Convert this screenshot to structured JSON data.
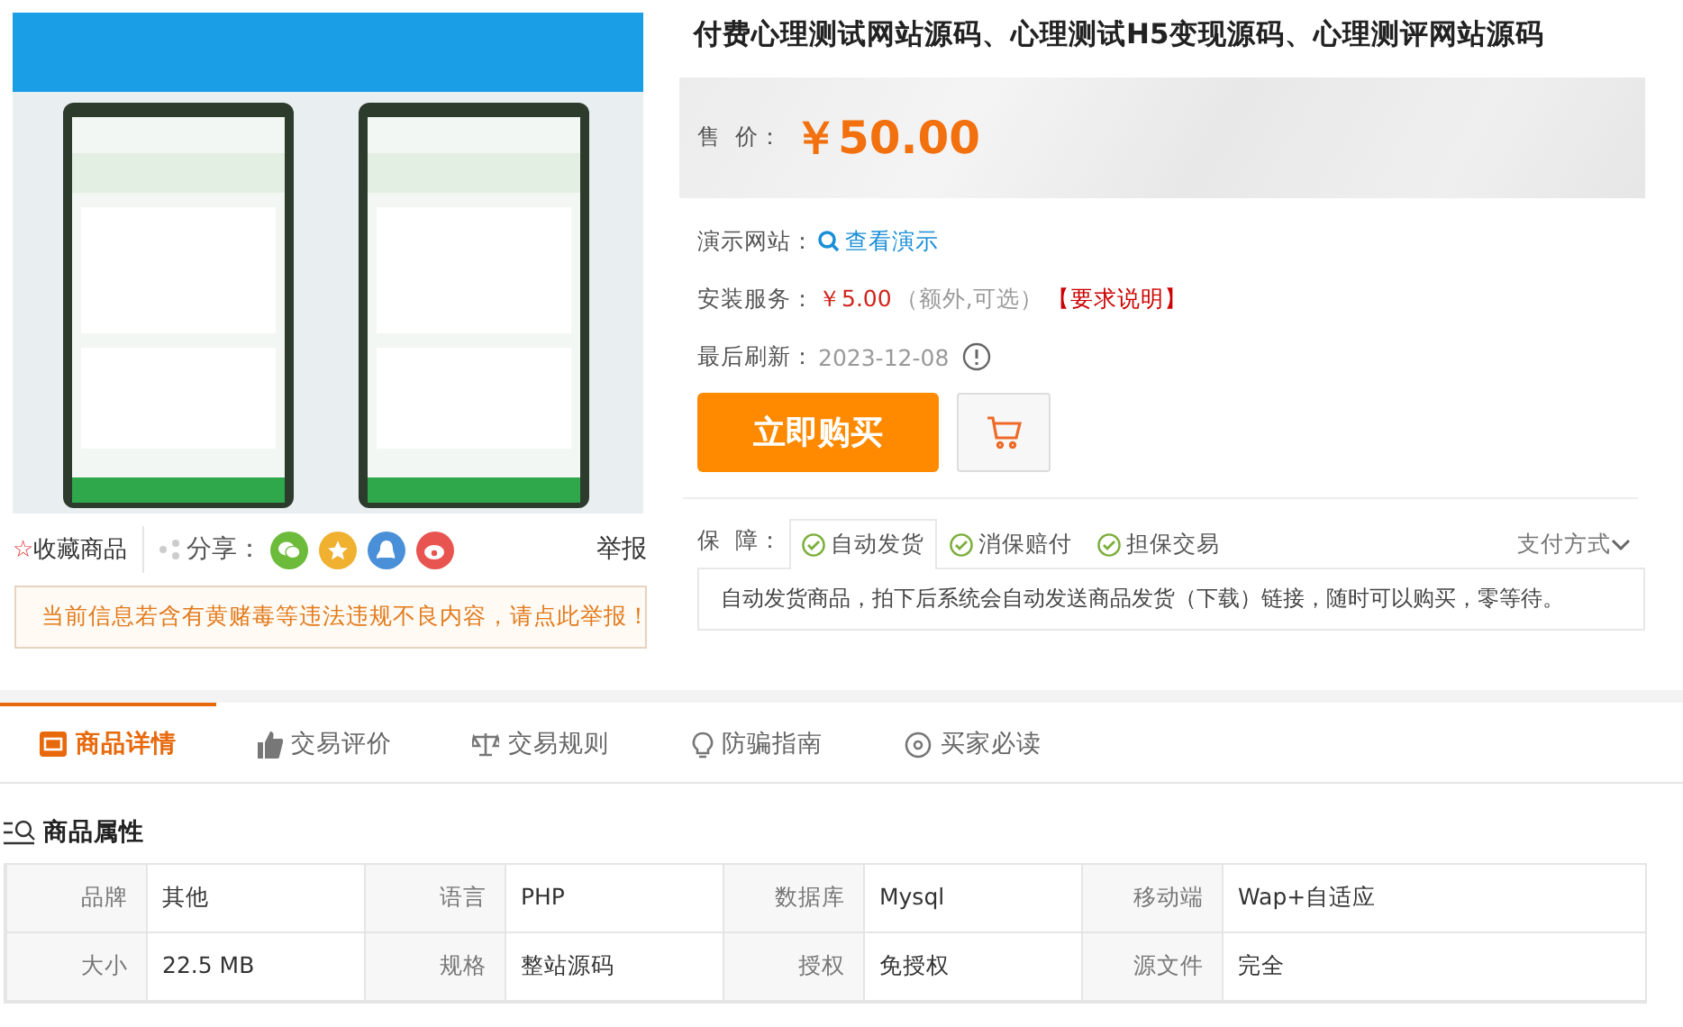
{
  "product": {
    "favorite": {
      "icon": "☆",
      "label": "收藏商品"
    },
    "share": {
      "label": "分享：",
      "targets": [
        {
          "kind": "wechat",
          "color": "#6dbb3a"
        },
        {
          "kind": "favorite",
          "color": "#f0b030"
        },
        {
          "kind": "qq",
          "color": "#4a90d9"
        },
        {
          "kind": "weibo",
          "color": "#e85450"
        }
      ]
    },
    "report": "举报",
    "notice": "当前信息若含有黄赌毒等违法违规不良内容，请点此举报！",
    "title": "付费心理测试网站源码、心理测试H5变现源码、心理测评网站源码",
    "price": {
      "label": "售  价：",
      "value": "￥50.00"
    },
    "info": [
      {
        "kind": "link",
        "label": "演示网站：",
        "value": "查看演示"
      },
      {
        "kind": "service",
        "label": "安装服务：",
        "value": "￥5.00",
        "note": "（额外,可选）",
        "link": "【要求说明】"
      },
      {
        "kind": "date",
        "label": "最后刷新：",
        "value": "2023-12-08"
      }
    ],
    "buy_button": "立即购买",
    "guarantee": {
      "label": "保  障：",
      "items": [
        {
          "label": "自动发货",
          "selected": true
        },
        {
          "label": "消保赔付",
          "selected": false
        },
        {
          "label": "担保交易",
          "selected": false
        }
      ],
      "payment": "支付方式",
      "description": "自动发货商品，拍下后系统会自动发送商品发货（下载）链接，随时可以购买，零等待。"
    }
  },
  "tabs": [
    {
      "label": "商品详情",
      "kind": "detail",
      "selected": true
    },
    {
      "label": "交易评价",
      "kind": "thumb",
      "selected": false
    },
    {
      "label": "交易规则",
      "kind": "scale",
      "selected": false
    },
    {
      "label": "防骗指南",
      "kind": "bulb",
      "selected": false
    },
    {
      "label": "买家必读",
      "kind": "target",
      "selected": false
    }
  ],
  "attributes": {
    "title": "商品属性",
    "rows": [
      [
        [
          "品牌",
          "其他"
        ],
        [
          "语言",
          "PHP"
        ],
        [
          "数据库",
          "Mysql"
        ],
        [
          "移动端",
          "Wap+自适应"
        ]
      ],
      [
        [
          "大小",
          "22.5 MB"
        ],
        [
          "规格",
          "整站源码"
        ],
        [
          "授权",
          "免授权"
        ],
        [
          "源文件",
          "完全"
        ]
      ]
    ]
  }
}
